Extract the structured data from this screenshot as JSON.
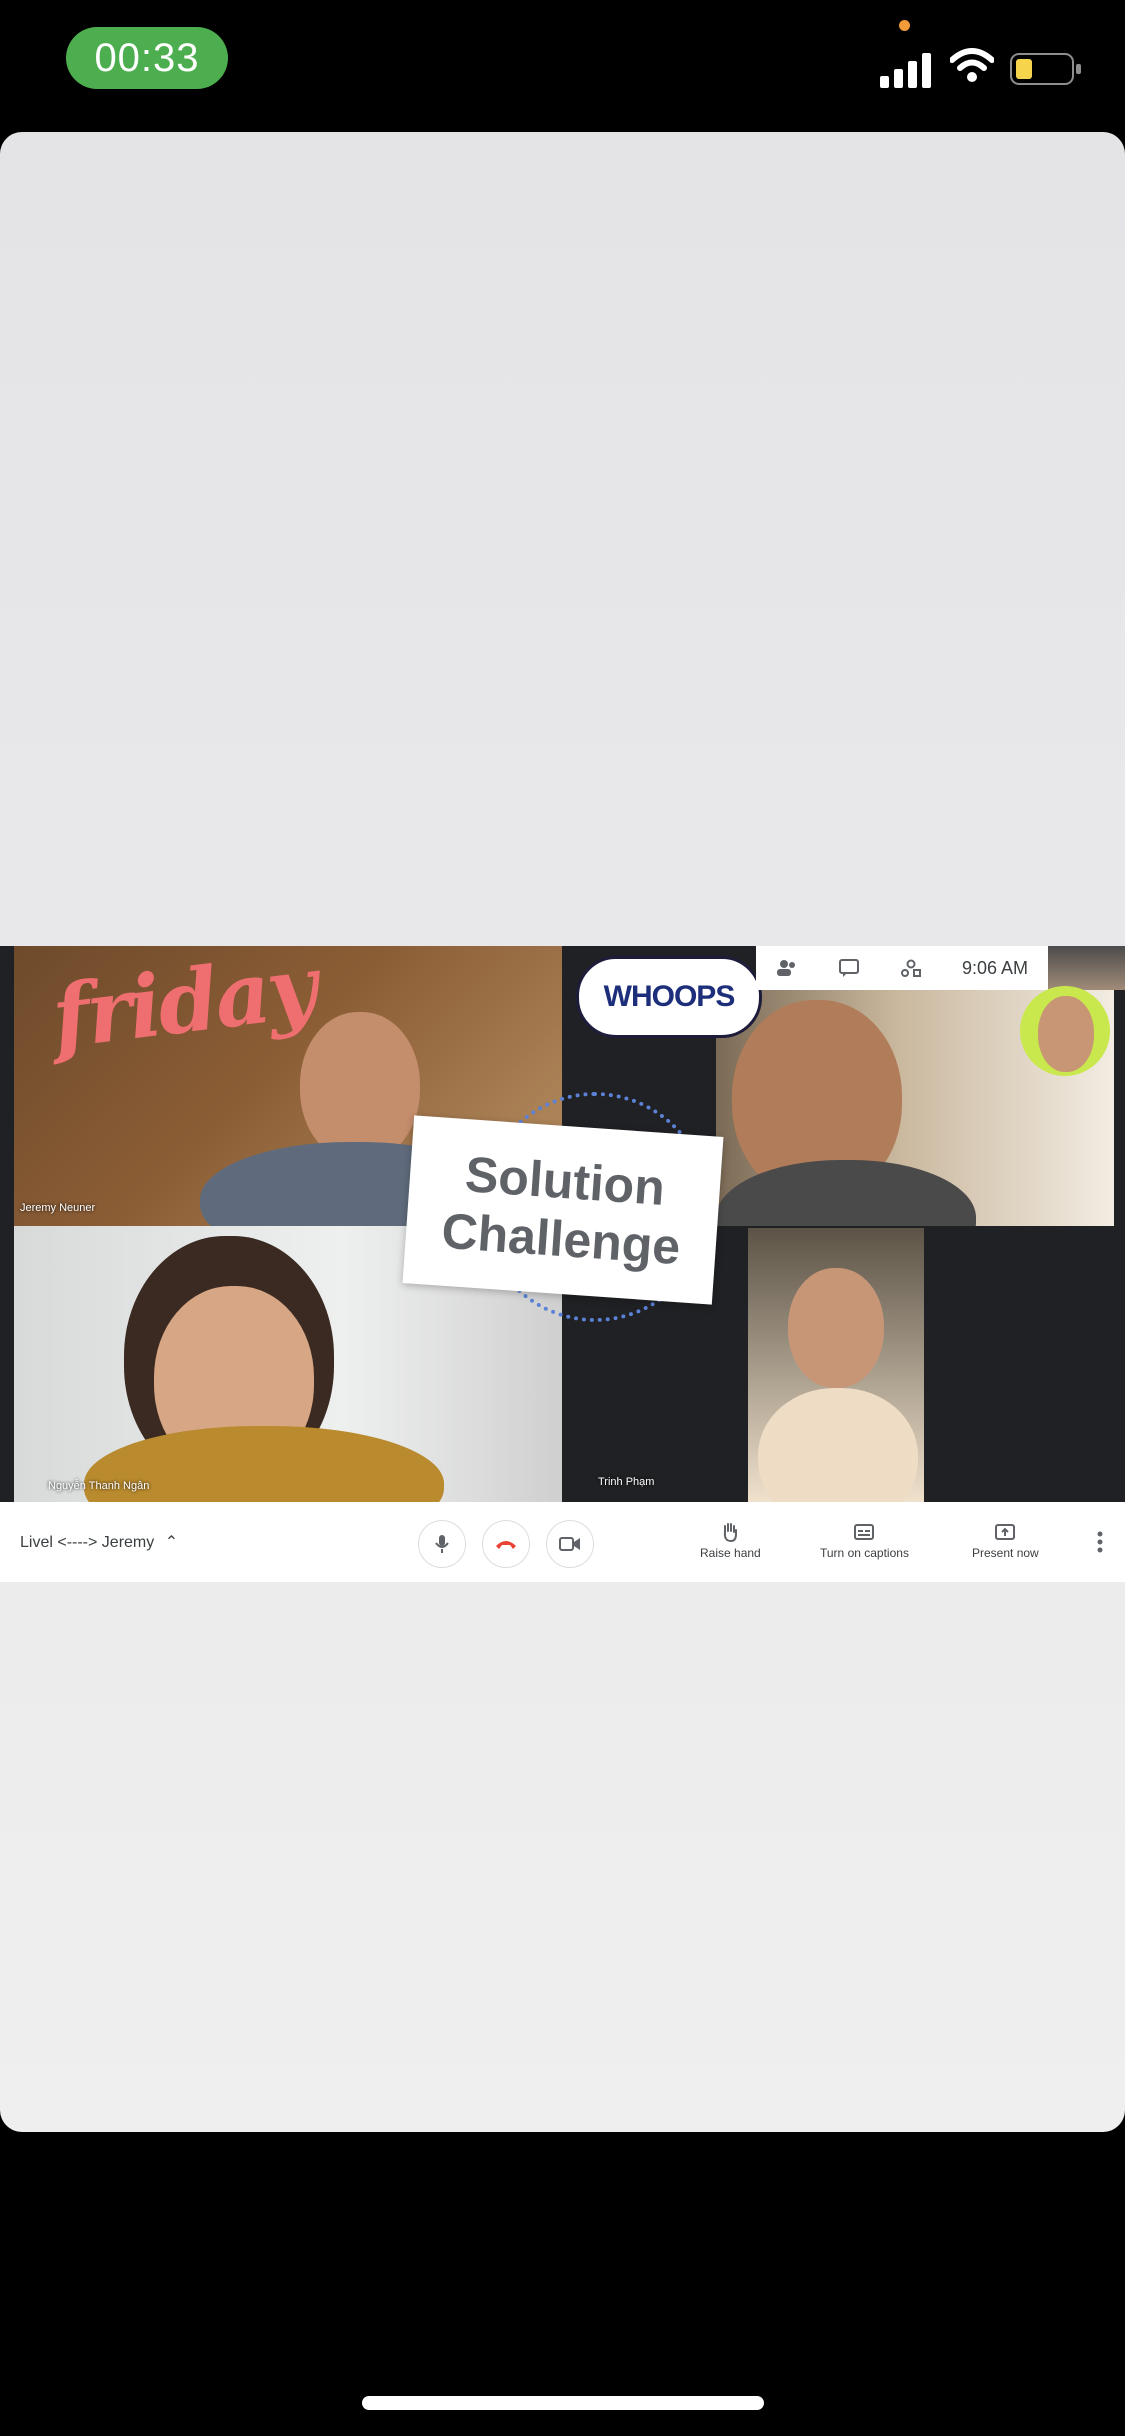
{
  "status_bar": {
    "time": "00:33",
    "icons": [
      "microphone-indicator-dot",
      "cellular-signal-icon",
      "wifi-icon",
      "battery-icon"
    ],
    "time_pill_color": "#4cae4f",
    "mic_dot_color": "#f29b38",
    "battery_fill_color": "#f6d54d"
  },
  "meeting": {
    "clock": "9:06 AM",
    "toolbar_icons": [
      "people-icon",
      "chat-icon",
      "activities-icon"
    ],
    "participants": [
      {
        "name": "Jeremy Neuner"
      },
      {
        "name": "Nguyễn Thanh Ngân"
      },
      {
        "name": "Trinh Phạm"
      }
    ],
    "stickers": {
      "friday": "friday",
      "whoops": "WHOOPS",
      "solution_line1": "Solution",
      "solution_line2": "Challenge"
    }
  },
  "controls": {
    "meeting_title": "Livel <----> Jeremy",
    "buttons": [
      {
        "label": "Raise hand",
        "icon": "hand-icon"
      },
      {
        "label": "Turn on captions",
        "icon": "captions-icon"
      },
      {
        "label": "Present now",
        "icon": "present-icon"
      }
    ],
    "round_buttons": [
      "microphone-icon",
      "hang-up-icon",
      "camera-icon"
    ],
    "accent_red": "#ea4335"
  }
}
